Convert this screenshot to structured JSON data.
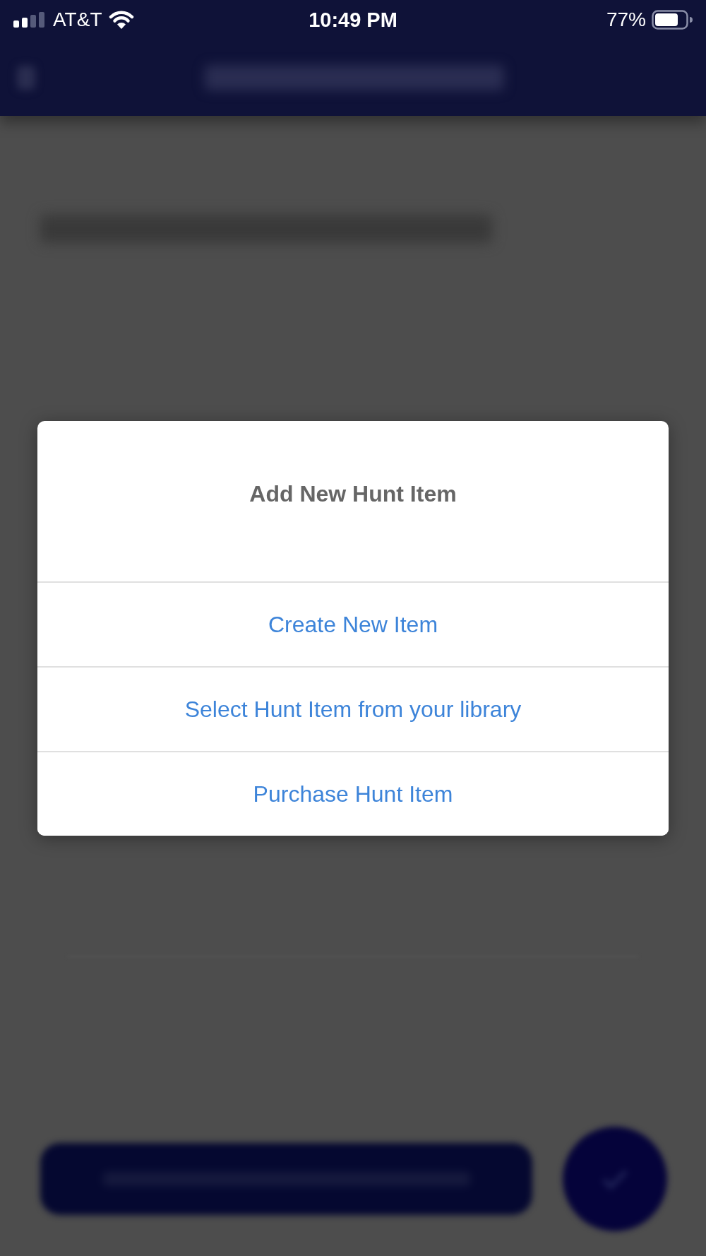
{
  "status_bar": {
    "carrier": "AT&T",
    "time": "10:49 PM",
    "battery": "77%"
  },
  "dialog": {
    "title": "Add New Hunt Item",
    "options": [
      "Create New Item",
      "Select Hunt Item from your library",
      "Purchase Hunt Item"
    ]
  }
}
